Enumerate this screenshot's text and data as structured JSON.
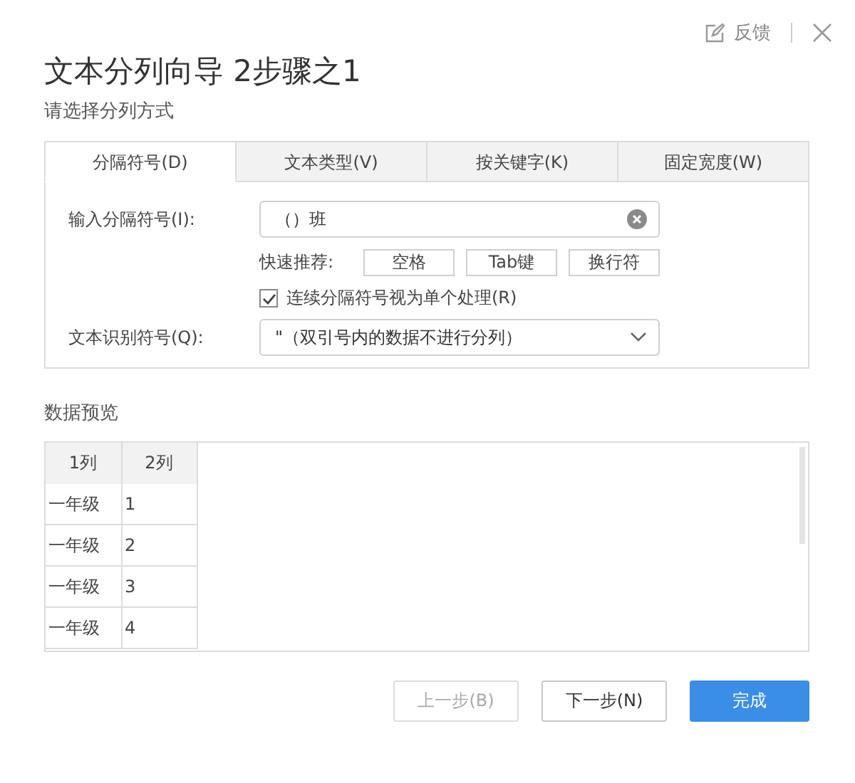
{
  "header": {
    "feedback": "反馈"
  },
  "window": {
    "title": "文本分列向导 2步骤之1"
  },
  "subtitle": "请选择分列方式",
  "tabs": [
    {
      "label": "分隔符号(D)",
      "selected": true
    },
    {
      "label": "文本类型(V)",
      "selected": false
    },
    {
      "label": "按关键字(K)",
      "selected": false
    },
    {
      "label": "固定宽度(W)",
      "selected": false
    }
  ],
  "delimiter": {
    "label": "输入分隔符号(I):",
    "value": "（）班"
  },
  "quick": {
    "label": "快速推荐:",
    "options": [
      "空格",
      "Tab键",
      "换行符"
    ]
  },
  "merge": {
    "label": "连续分隔符号视为单个处理(R)",
    "checked": true
  },
  "qualifier": {
    "label": "文本识别符号(Q):",
    "value": "\"（双引号内的数据不进行分列）"
  },
  "preview": {
    "title": "数据预览",
    "columns": [
      "1列",
      "2列"
    ],
    "rows": [
      [
        "一年级",
        "1"
      ],
      [
        "一年级",
        "2"
      ],
      [
        "一年级",
        "3"
      ],
      [
        "一年级",
        "4"
      ]
    ]
  },
  "buttons": [
    {
      "label": "上一步(B)",
      "kind": "default",
      "disabled": true
    },
    {
      "label": "下一步(N)",
      "kind": "default",
      "disabled": false
    },
    {
      "label": "完成",
      "kind": "primary",
      "disabled": false
    }
  ]
}
